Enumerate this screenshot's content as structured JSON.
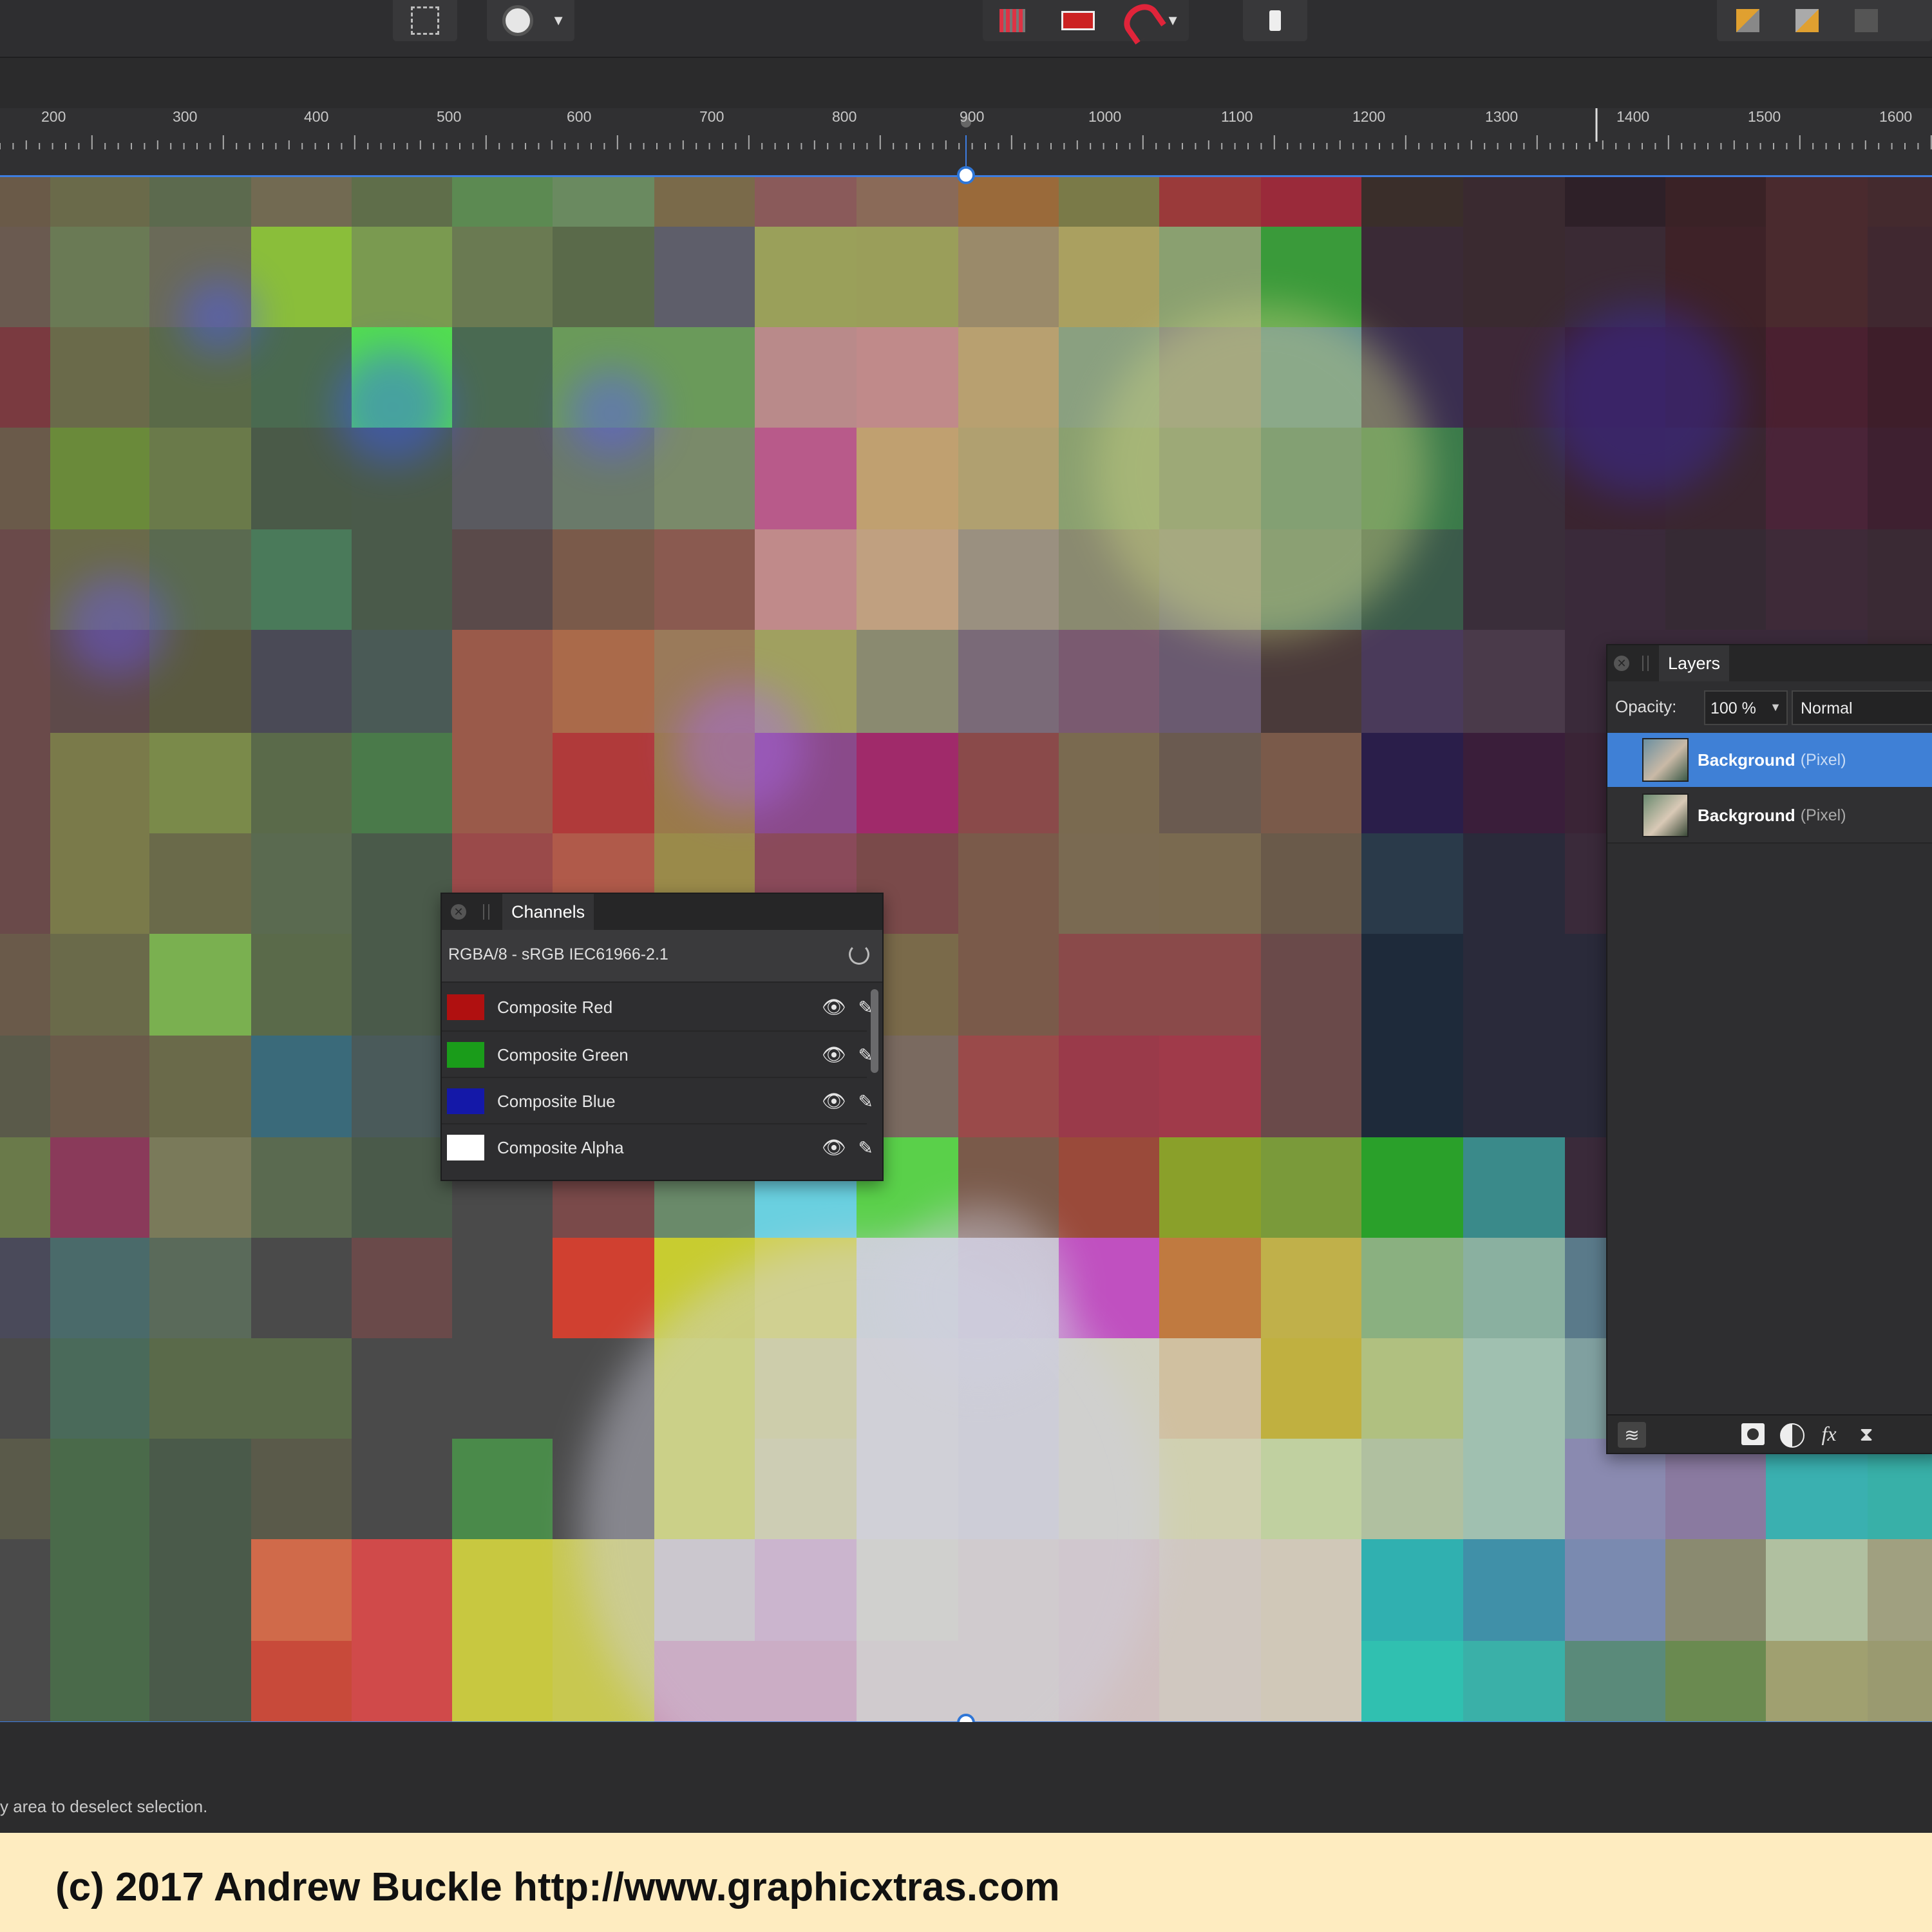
{
  "ruler": {
    "ticks": [
      "200",
      "300",
      "400",
      "500",
      "600",
      "700",
      "800",
      "900",
      "1000",
      "1100",
      "1200",
      "1300",
      "1400",
      "1500",
      "1600"
    ]
  },
  "channels": {
    "tab": "Channels",
    "format": "RGBA/8 - sRGB IEC61966-2.1",
    "rows": [
      {
        "label": "Composite Red",
        "color": "#b01010"
      },
      {
        "label": "Composite Green",
        "color": "#1a9c1a"
      },
      {
        "label": "Composite Blue",
        "color": "#1418a8"
      },
      {
        "label": "Composite Alpha",
        "color": "#ffffff"
      }
    ]
  },
  "layers": {
    "tab": "Layers",
    "opacity_label": "Opacity:",
    "opacity_value": "100 %",
    "blend_mode": "Normal",
    "items": [
      {
        "name": "Background",
        "type": "(Pixel)",
        "selected": true
      },
      {
        "name": "Background",
        "type": "(Pixel)",
        "selected": false
      }
    ]
  },
  "status": {
    "hint": "y area to deselect selection."
  },
  "footer": {
    "credit": "(c) 2017 Andrew Buckle http://www.graphicxtras.com"
  },
  "colors": {
    "accent": "#3d7de0",
    "selected_row": "#3f80d6",
    "footer_bg": "#feecc0"
  }
}
